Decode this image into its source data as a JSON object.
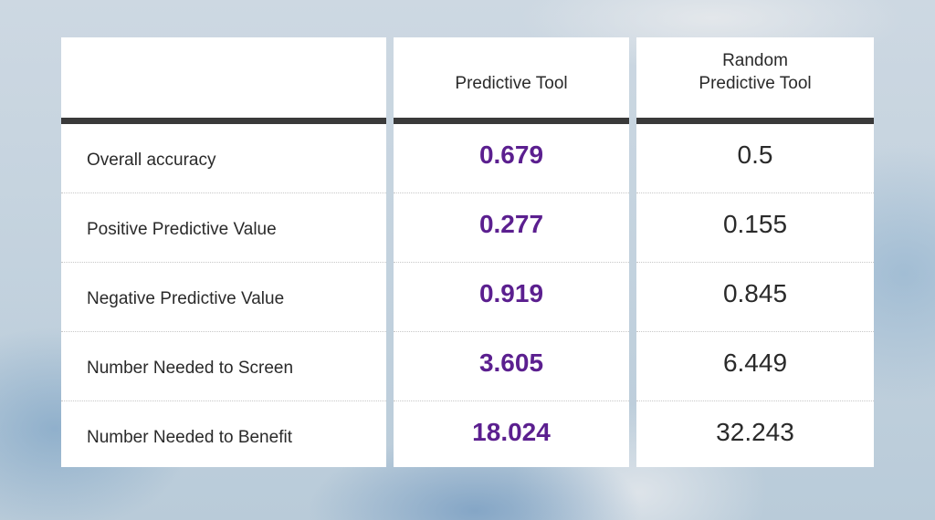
{
  "chart_data": {
    "type": "table",
    "title": "",
    "columns": [
      "",
      "Predictive Tool",
      "Random Predictive Tool"
    ],
    "header_lines": {
      "predictive": [
        "Predictive Tool"
      ],
      "random": [
        "Random",
        "Predictive Tool"
      ]
    },
    "rows": [
      {
        "metric": "Overall accuracy",
        "predictive": "0.679",
        "random": "0.5"
      },
      {
        "metric": "Positive Predictive Value",
        "predictive": "0.277",
        "random": "0.155"
      },
      {
        "metric": "Negative Predictive Value",
        "predictive": "0.919",
        "random": "0.845"
      },
      {
        "metric": "Number Needed to Screen",
        "predictive": "3.605",
        "random": "6.449"
      },
      {
        "metric": "Number Needed to Benefit",
        "predictive": "18.024",
        "random": "32.243"
      }
    ],
    "colors": {
      "predictive_value": "#5b1f8f",
      "random_value": "#2a2a2a",
      "header_rule": "#3a3a3a"
    }
  }
}
